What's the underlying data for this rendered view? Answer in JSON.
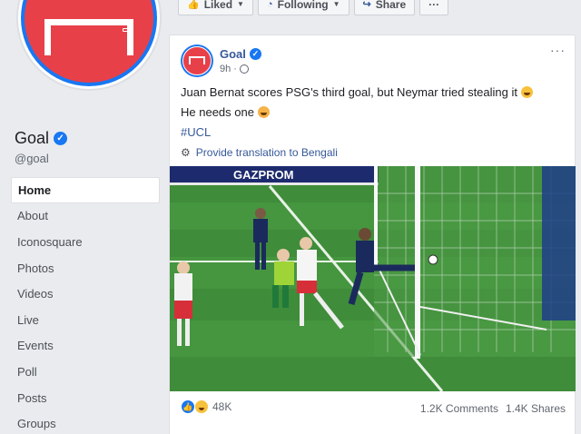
{
  "topbar": {
    "liked_label": "Liked",
    "following_label": "Following",
    "share_label": "Share",
    "more_label": "···"
  },
  "page": {
    "name": "Goal",
    "handle": "@goal"
  },
  "nav": {
    "items": [
      {
        "label": "Home",
        "active": true
      },
      {
        "label": "About"
      },
      {
        "label": "Iconosquare"
      },
      {
        "label": "Photos"
      },
      {
        "label": "Videos"
      },
      {
        "label": "Live"
      },
      {
        "label": "Events"
      },
      {
        "label": "Poll"
      },
      {
        "label": "Posts"
      },
      {
        "label": "Groups"
      }
    ]
  },
  "post": {
    "author": "Goal",
    "time": "9h",
    "line1": "Juan Bernat scores PSG's third goal, but Neymar tried stealing it",
    "line2": "He needs one",
    "hashtag": "#UCL",
    "translate": "Provide translation to Bengali",
    "more": "···",
    "reaction_count": "48K",
    "comments": "1.2K Comments",
    "shares": "1.4K Shares",
    "board_text": "GAZPROM"
  },
  "colors": {
    "brand_red": "#e84049",
    "fb_blue": "#1877f2",
    "link_blue": "#365899"
  }
}
